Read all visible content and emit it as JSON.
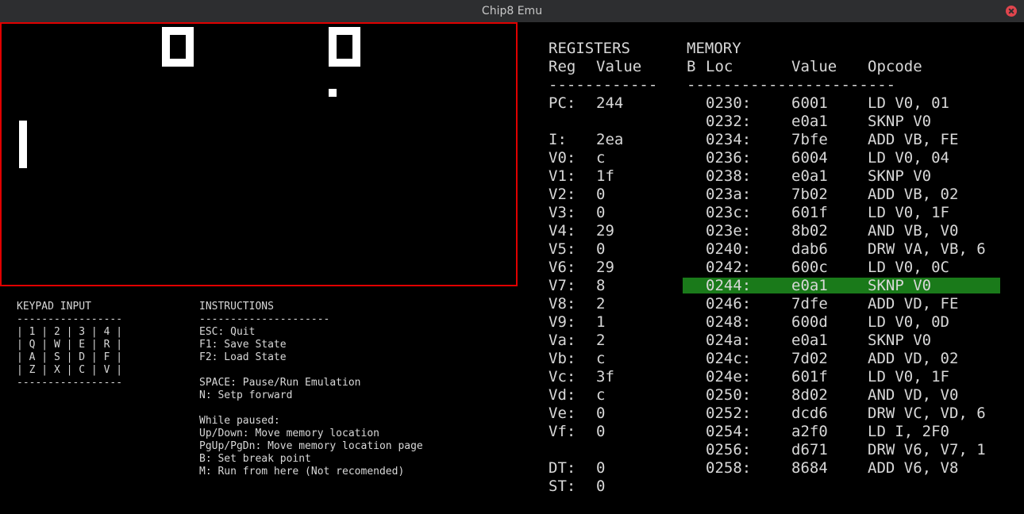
{
  "window": {
    "title": "Chip8 Emu"
  },
  "keypad": {
    "title": "KEYPAD INPUT",
    "divider": "-----------------",
    "rows": [
      "| 1 | 2 | 3 | 4 |",
      "| Q | W | E | R |",
      "| A | S | D | F |",
      "| Z | X | C | V |"
    ],
    "divider_bottom": "-----------------"
  },
  "instructions": {
    "title": "INSTRUCTIONS",
    "divider": "---------------------",
    "lines": [
      "ESC: Quit",
      "F1: Save State",
      "F2: Load State",
      "",
      "SPACE: Pause/Run Emulation",
      "N: Setp forward",
      "",
      "While paused:",
      "Up/Down: Move memory location",
      "PgUp/PgDn: Move memory location page",
      "B: Set break point",
      "M: Run from here (Not recomended)"
    ]
  },
  "registers": {
    "title": "REGISTERS",
    "col_reg": "Reg",
    "col_value": "Value",
    "divider": "------------",
    "pc_label": "PC:",
    "pc_value": "244",
    "list": [
      {
        "name": "I:",
        "value": "2ea"
      },
      {
        "name": "V0:",
        "value": "c"
      },
      {
        "name": "V1:",
        "value": "1f"
      },
      {
        "name": "V2:",
        "value": "0"
      },
      {
        "name": "V3:",
        "value": "0"
      },
      {
        "name": "V4:",
        "value": "29"
      },
      {
        "name": "V5:",
        "value": "0"
      },
      {
        "name": "V6:",
        "value": "29"
      },
      {
        "name": "V7:",
        "value": "8"
      },
      {
        "name": "V8:",
        "value": "2"
      },
      {
        "name": "V9:",
        "value": "1"
      },
      {
        "name": "Va:",
        "value": "2"
      },
      {
        "name": "Vb:",
        "value": "c"
      },
      {
        "name": "Vc:",
        "value": "3f"
      },
      {
        "name": "Vd:",
        "value": "c"
      },
      {
        "name": "Ve:",
        "value": "0"
      },
      {
        "name": "Vf:",
        "value": "0"
      }
    ],
    "timers": [
      {
        "name": "DT:",
        "value": "0"
      },
      {
        "name": "ST:",
        "value": "0"
      }
    ]
  },
  "memory": {
    "title": "MEMORY",
    "col_b": "B",
    "col_loc": "Loc",
    "col_value": "Value",
    "col_opcode": "Opcode",
    "divider": "-----------------------",
    "highlight_color": "#1a7a1a",
    "rows": [
      {
        "loc": "0230:",
        "value": "6001",
        "opcode": "LD V0, 01"
      },
      {
        "loc": "0232:",
        "value": "e0a1",
        "opcode": "SKNP V0"
      },
      {
        "loc": "0234:",
        "value": "7bfe",
        "opcode": "ADD VB, FE"
      },
      {
        "loc": "0236:",
        "value": "6004",
        "opcode": "LD V0, 04"
      },
      {
        "loc": "0238:",
        "value": "e0a1",
        "opcode": "SKNP V0"
      },
      {
        "loc": "023a:",
        "value": "7b02",
        "opcode": "ADD VB, 02"
      },
      {
        "loc": "023c:",
        "value": "601f",
        "opcode": "LD V0, 1F"
      },
      {
        "loc": "023e:",
        "value": "8b02",
        "opcode": "AND VB, V0"
      },
      {
        "loc": "0240:",
        "value": "dab6",
        "opcode": "DRW VA, VB, 6"
      },
      {
        "loc": "0242:",
        "value": "600c",
        "opcode": "LD V0, 0C"
      },
      {
        "loc": "0244:",
        "value": "e0a1",
        "opcode": "SKNP V0",
        "current": true
      },
      {
        "loc": "0246:",
        "value": "7dfe",
        "opcode": "ADD VD, FE"
      },
      {
        "loc": "0248:",
        "value": "600d",
        "opcode": "LD V0, 0D"
      },
      {
        "loc": "024a:",
        "value": "e0a1",
        "opcode": "SKNP V0"
      },
      {
        "loc": "024c:",
        "value": "7d02",
        "opcode": "ADD VD, 02"
      },
      {
        "loc": "024e:",
        "value": "601f",
        "opcode": "LD V0, 1F"
      },
      {
        "loc": "0250:",
        "value": "8d02",
        "opcode": "AND VD, V0"
      },
      {
        "loc": "0252:",
        "value": "dcd6",
        "opcode": "DRW VC, VD, 6"
      },
      {
        "loc": "0254:",
        "value": "a2f0",
        "opcode": "LD I, 2F0"
      },
      {
        "loc": "0256:",
        "value": "d671",
        "opcode": "DRW V6, V7, 1"
      },
      {
        "loc": "0258:",
        "value": "8684",
        "opcode": "ADD V6, V8"
      }
    ]
  }
}
